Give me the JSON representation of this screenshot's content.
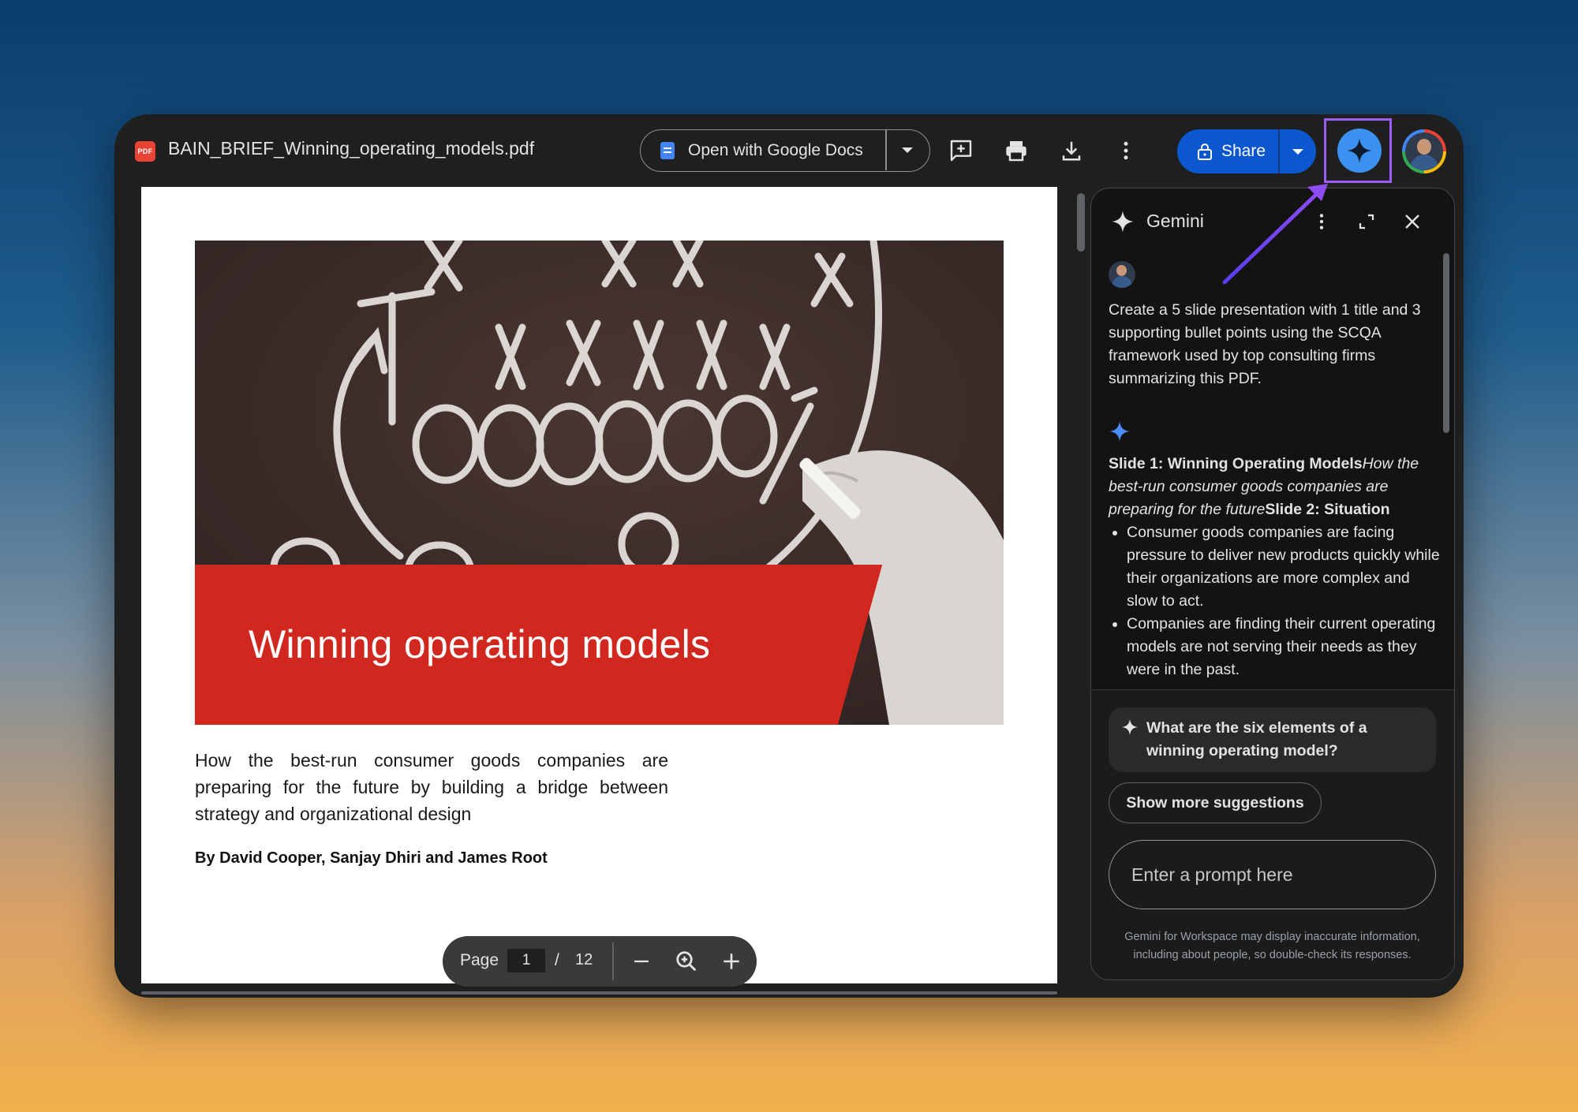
{
  "file": {
    "badge": "PDF",
    "name": "BAIN_BRIEF_Winning_operating_models.pdf"
  },
  "toolbar": {
    "open_with_label": "Open with Google Docs",
    "share_label": "Share",
    "icons": [
      "add-comment-icon",
      "print-icon",
      "download-icon",
      "more-vert-icon"
    ]
  },
  "document": {
    "hero_title": "Winning operating models",
    "subtitle": "How the best-run consumer goods companies are preparing for the future by building a bridge between strategy and organizational design",
    "authors": "By David Cooper, Sanjay Dhiri and James Root"
  },
  "pager": {
    "page_label": "Page",
    "current": "1",
    "separator": "/",
    "total": "12"
  },
  "gemini": {
    "title": "Gemini",
    "prompt": "Create a 5 slide presentation with 1 title and 3 supporting bullet points using the SCQA framework used by top consulting firms summarizing this PDF.",
    "response": {
      "slide1_heading": "Slide 1: Winning Operating Models",
      "slide1_sub": "How the best-run consumer goods companies are preparing for the future",
      "slide2_heading": "Slide 2: Situation",
      "bullets": [
        "Consumer goods companies are facing pressure to deliver new products quickly while their organizations are more complex and slow to act.",
        "Companies are finding their current operating models are not serving their needs as they were in the past."
      ]
    },
    "suggestion": "What are the six elements of a winning operating model?",
    "show_more_label": "Show more suggestions",
    "input_placeholder": "Enter a prompt here",
    "disclaimer": "Gemini for Workspace may display inaccurate information, including about people, so double-check its responses."
  },
  "colors": {
    "accent_blue": "#0b57d0",
    "gemini_blue": "#3b91f0",
    "highlight_purple": "#9d5cf4",
    "hero_red": "#d0281f",
    "pdf_red": "#ea4335"
  }
}
